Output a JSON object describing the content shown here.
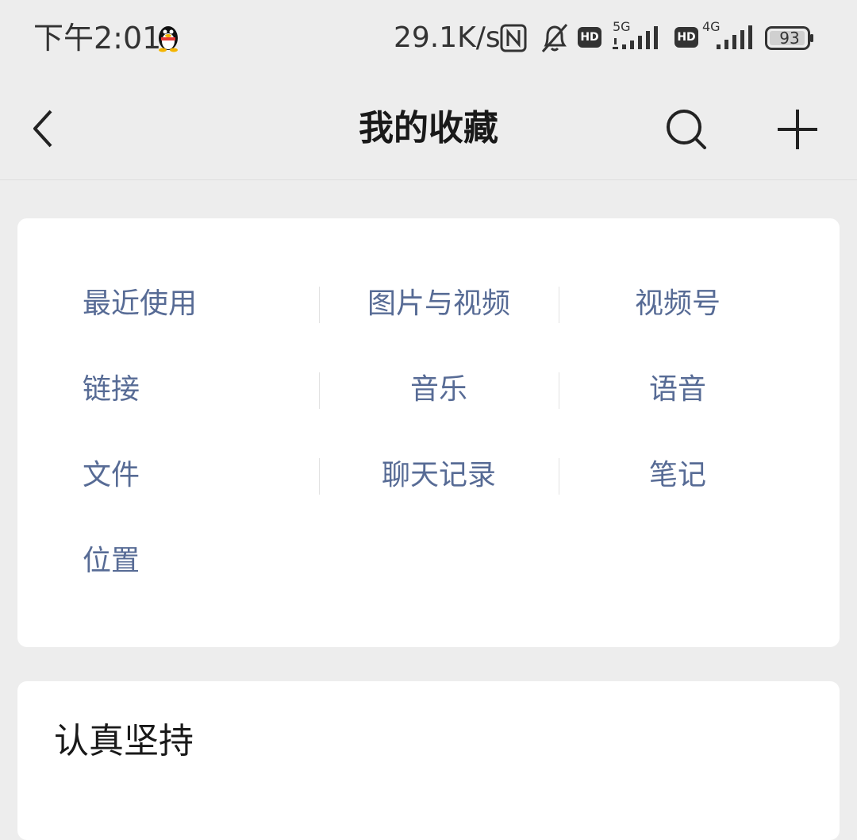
{
  "status_bar": {
    "time": "下午2:01",
    "net_speed": "29.1K/s",
    "hd_label": "HD",
    "network_1": "5G",
    "network_2": "4G",
    "battery": "93"
  },
  "header": {
    "title": "我的收藏"
  },
  "categories": [
    "最近使用",
    "图片与视频",
    "视频号",
    "链接",
    "音乐",
    "语音",
    "文件",
    "聊天记录",
    "笔记",
    "位置"
  ],
  "note": {
    "title": "认真坚持"
  },
  "colors": {
    "background": "#ededed",
    "card": "#ffffff",
    "link_blue": "#576b95",
    "text_dark": "#191919"
  },
  "icons": {
    "back": "chevron-left-icon",
    "search": "search-icon",
    "add": "plus-icon",
    "qq": "qq-penguin-icon",
    "nfc": "nfc-icon",
    "mute": "bell-off-icon",
    "battery": "battery-icon"
  }
}
